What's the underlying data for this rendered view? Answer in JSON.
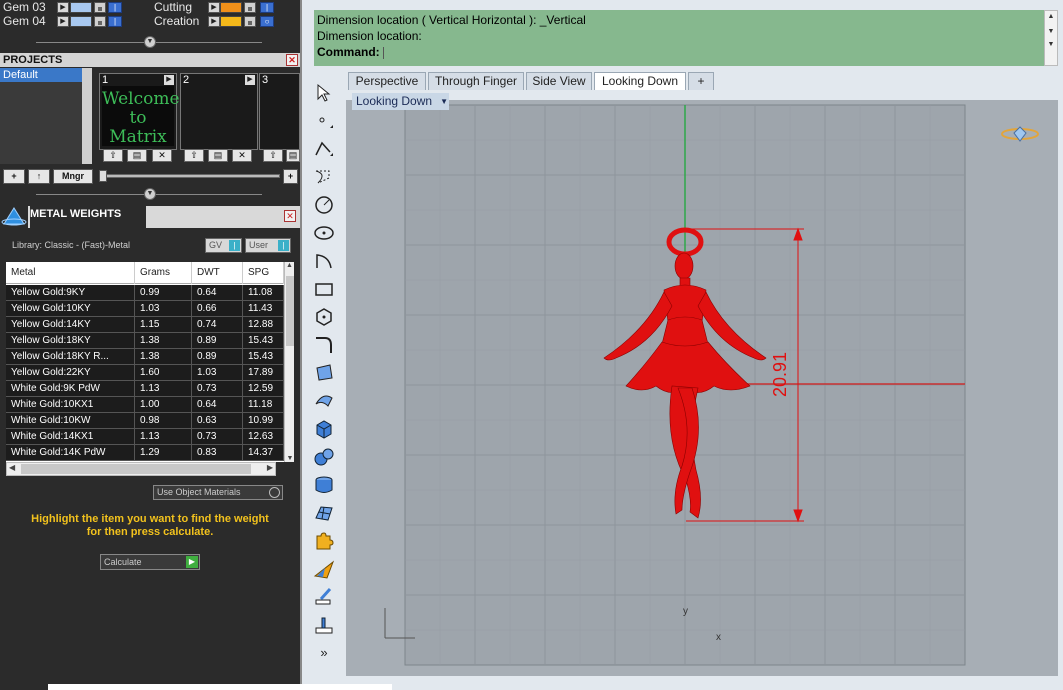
{
  "layers": [
    {
      "name": "Gem 03",
      "color": "#a8c8f0"
    },
    {
      "name": "Gem 04",
      "color": "#a8c8f0"
    }
  ],
  "layers_right": [
    {
      "name": "Cutting",
      "color": "#f0901a"
    },
    {
      "name": "Creation",
      "color": "#f4b81a"
    }
  ],
  "projects": {
    "title": "PROJECTS",
    "list_item": "Default",
    "slots": [
      {
        "num": "1",
        "thumb_line1": "Welcome to",
        "thumb_line2": "Matrix"
      },
      {
        "num": "2"
      },
      {
        "num": "3"
      }
    ],
    "buttons": {
      "add": "+",
      "up": "↑",
      "mngr": "Mngr",
      "plus": "+"
    }
  },
  "metal_weights": {
    "title": "METAL WEIGHTS",
    "library": "Library: Classic - (Fast)-Metal",
    "gv_label": "GV",
    "user_label": "User",
    "columns": [
      "Metal",
      "Grams",
      "DWT",
      "SPG"
    ],
    "rows": [
      [
        "Yellow Gold:9KY",
        "0.99",
        "0.64",
        "11.08"
      ],
      [
        "Yellow Gold:10KY",
        "1.03",
        "0.66",
        "11.43"
      ],
      [
        "Yellow Gold:14KY",
        "1.15",
        "0.74",
        "12.88"
      ],
      [
        "Yellow Gold:18KY",
        "1.38",
        "0.89",
        "15.43"
      ],
      [
        "Yellow Gold:18KY R...",
        "1.38",
        "0.89",
        "15.43"
      ],
      [
        "Yellow Gold:22KY",
        "1.60",
        "1.03",
        "17.89"
      ],
      [
        "White Gold:9K PdW",
        "1.13",
        "0.73",
        "12.59"
      ],
      [
        "White Gold:10KX1",
        "1.00",
        "0.64",
        "11.18"
      ],
      [
        "White Gold:10KW",
        "0.98",
        "0.63",
        "10.99"
      ],
      [
        "White Gold:14KX1",
        "1.13",
        "0.73",
        "12.63"
      ],
      [
        "White Gold:14K PdW",
        "1.29",
        "0.83",
        "14.37"
      ]
    ],
    "use_object_materials": "Use Object Materials",
    "hint_line1": "Highlight the item you want to find the weight",
    "hint_line2": "for then press calculate.",
    "calculate": "Calculate"
  },
  "command": {
    "line1": "Dimension location ( Vertical  Horizontal ): _Vertical",
    "line2": "Dimension location:",
    "prompt": "Command:"
  },
  "tabs": [
    "Perspective",
    "Through Finger",
    "Side View",
    "Looking Down",
    "+"
  ],
  "active_tab": "Looking Down",
  "viewport": {
    "label": "Looking Down",
    "dimension_value": "20.91",
    "axis_y": "y",
    "axis_x": "x"
  },
  "colors": {
    "model": "#e01010",
    "command_bg": "#86b88e",
    "hint": "#f2c21d",
    "accent_blue": "#3a78c8"
  }
}
